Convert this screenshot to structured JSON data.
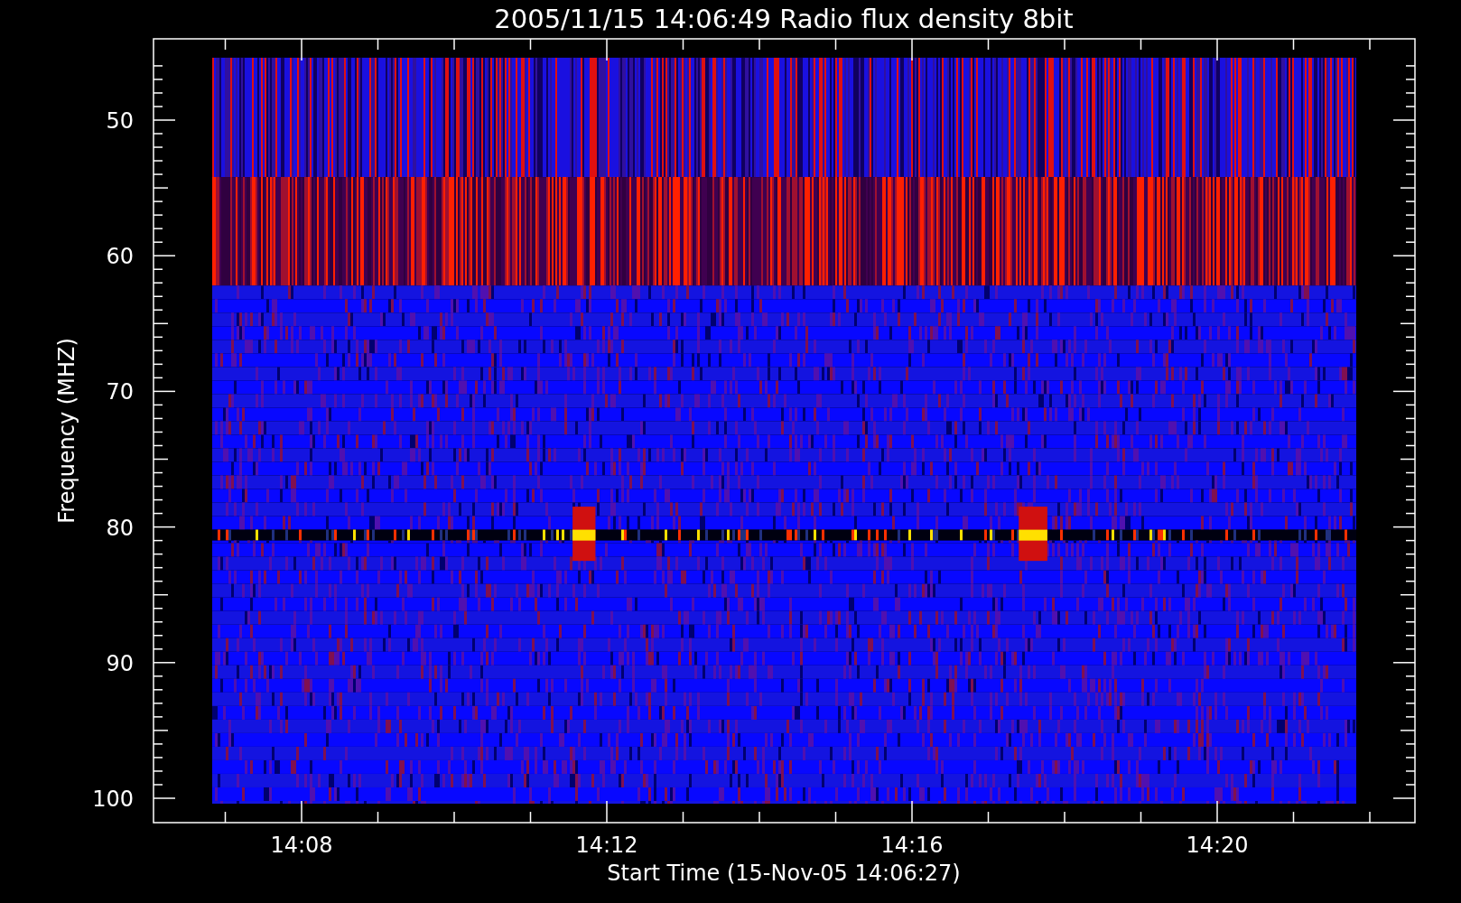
{
  "title": "2005/11/15 14:06:49 Radio flux density 8bit",
  "y_axis": {
    "label": "Frequency (MHZ)",
    "ticks": [
      "50",
      "60",
      "70",
      "80",
      "90",
      "100"
    ]
  },
  "x_axis": {
    "label": "Start Time (15-Nov-05 14:06:27)",
    "ticks": [
      "14:08",
      "14:12",
      "14:16",
      "14:20"
    ]
  }
}
